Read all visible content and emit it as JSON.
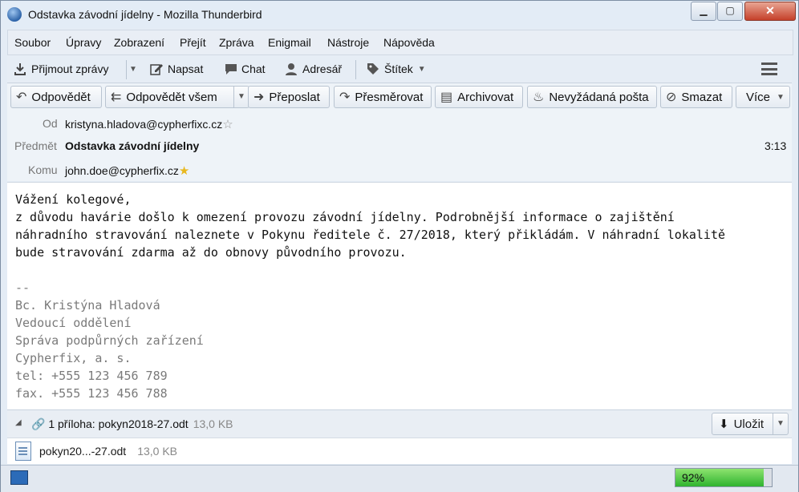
{
  "window": {
    "title": "Odstavka závodní jídelny - Mozilla Thunderbird",
    "app_icon": "thunderbird-icon"
  },
  "menubar": [
    "Soubor",
    "Úpravy",
    "Zobrazení",
    "Přejít",
    "Zpráva",
    "Enigmail",
    "Nástroje",
    "Nápověda"
  ],
  "toolbar": {
    "get_mail": "Přijmout zprávy",
    "write": "Napsat",
    "chat": "Chat",
    "address_book": "Adresář",
    "tag": "Štítek"
  },
  "header_buttons": {
    "reply": "Odpovědět",
    "reply_all": "Odpovědět všem",
    "forward": "Přeposlat",
    "redirect": "Přesměrovat",
    "archive": "Archivovat",
    "junk": "Nevyžádaná pošta",
    "delete": "Smazat",
    "more": "Více"
  },
  "message": {
    "from_label": "Od",
    "from": "kristyna.hladova@cypherfixc.cz",
    "subject_label": "Předmět",
    "subject": "Odstavka závodní jídelny",
    "time": "3:13",
    "to_label": "Komu",
    "to": "john.doe@cypherfix.cz",
    "body": "Vážení kolegové,\nz důvodu havárie došlo k omezení provozu závodní jídelny. Podrobnější informace o zajištění\nnáhradního stravování naleznete v Pokynu ředitele č. 27/2018, který přikládám. V náhradní lokalitě\nbude stravování zdarma až do obnovy původního provozu.",
    "signature": "--\nBc. Kristýna Hladová\nVedoucí oddělení\nSpráva podpůrných zařízení\nCypherfix, a. s.\ntel: +555 123 456 789\nfax. +555 123 456 788"
  },
  "attachments": {
    "summary": "1 příloha: pokyn2018-27.odt",
    "summary_size": "13,0 KB",
    "save_label": "Uložit",
    "file_name": "pokyn20...-27.odt",
    "file_size": "13,0 KB"
  },
  "status": {
    "progress_text": "92%",
    "progress_value": 0.92
  }
}
